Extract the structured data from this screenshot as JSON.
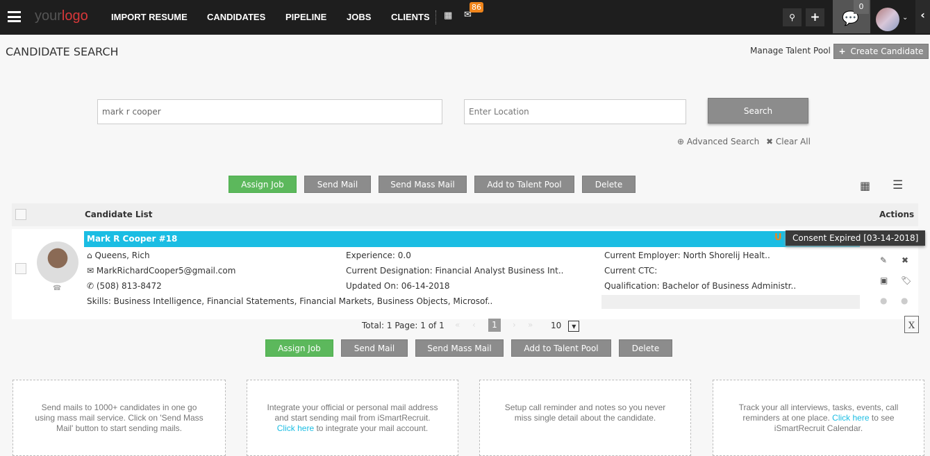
{
  "nav": {
    "logo_a": "your",
    "logo_b": "logo",
    "links": [
      "IMPORT RESUME",
      "CANDIDATES",
      "PIPELINE",
      "JOBS",
      "CLIENTS"
    ],
    "mail_badge": "86",
    "chat_badge": "0"
  },
  "header": {
    "title": "CANDIDATE SEARCH",
    "manage_pool": "Manage Talent Pool",
    "create_candidate": "Create Candidate"
  },
  "search": {
    "keyword_value": "mark r cooper",
    "location_placeholder": "Enter Location",
    "search_label": "Search",
    "advanced": "Advanced Search",
    "clear": "Clear All"
  },
  "actions": [
    "Assign Job",
    "Send Mail",
    "Send Mass Mail",
    "Add to Talent Pool",
    "Delete"
  ],
  "table": {
    "header": "Candidate List",
    "actions_header": "Actions"
  },
  "candidate": {
    "name": "Mark R Cooper #18",
    "consent": "Consent Expired [03-14-2018]",
    "location": "Queens, Rich",
    "email": "MarkRichardCooper5@gmail.com",
    "phone": "(508) 813-8472",
    "skills": "Skills: Business Intelligence, Financial Statements, Financial Markets, Business Objects, Microsof..",
    "experience": "Experience: 0.0",
    "designation": "Current Designation: Financial Analyst Business Int..",
    "updated": "Updated On: 06-14-2018",
    "employer": "Current Employer: North Shorelij Healt..",
    "ctc": "Current CTC:",
    "qualification": "Qualification: Bachelor of Business Administr.."
  },
  "pagination": {
    "summary": "Total: 1 Page: 1 of 1",
    "current": "1",
    "page_size": "10"
  },
  "cards": [
    {
      "text": "Send mails to 1000+ candidates in one go using mass mail service. Click on 'Send Mass Mail' button to start sending mails."
    },
    {
      "before": "Integrate your official or personal mail address and start sending mail from iSmartRecruit. ",
      "link": "Click here",
      "after": " to integrate your mail account."
    },
    {
      "text": "Setup call reminder and notes so you never miss single detail about the candidate."
    },
    {
      "before": "Track your all interviews, tasks, events, call reminders at one place. ",
      "link": "Click here",
      "after": " to see iSmartRecruit Calendar."
    }
  ],
  "colors": {
    "accent": "#1bbde3",
    "green": "#5cb85c",
    "nav": "#1e1e1e",
    "badge": "#f0851b"
  }
}
